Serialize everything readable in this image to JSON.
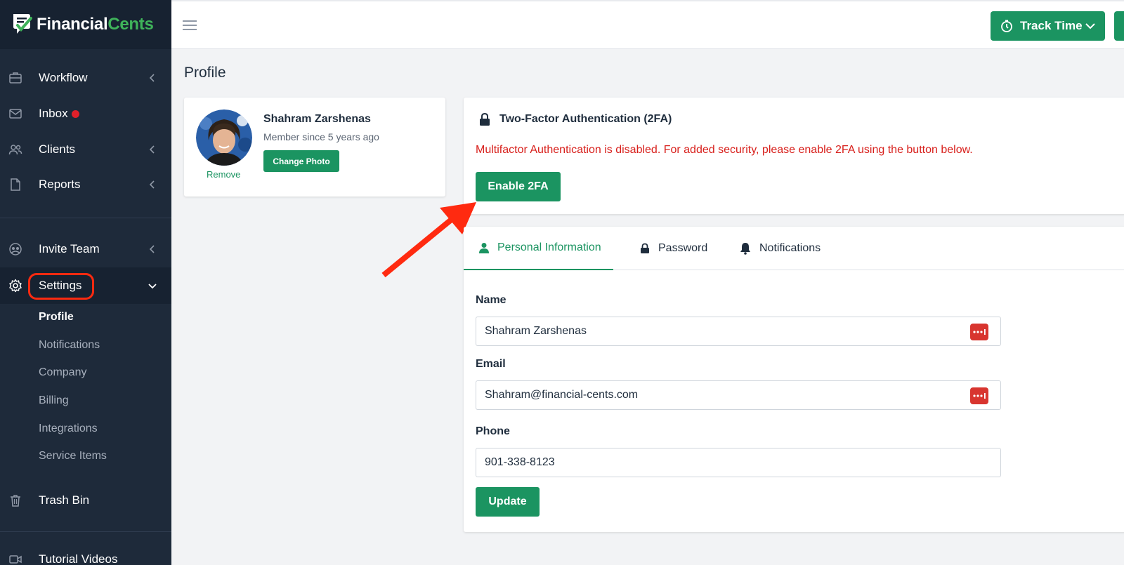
{
  "brand": {
    "name_a": "Financial",
    "name_b": "Cents",
    "green": "#1b9461",
    "sidebar_bg": "#1e2a3a",
    "alert_red": "#d8201c"
  },
  "sidebar": {
    "items": [
      {
        "label": "Workflow",
        "icon": "briefcase-icon"
      },
      {
        "label": "Inbox",
        "icon": "mail-icon"
      },
      {
        "label": "Clients",
        "icon": "users-icon"
      },
      {
        "label": "Reports",
        "icon": "file-icon"
      },
      {
        "label": "Invite Team",
        "icon": "team-icon"
      },
      {
        "label": "Settings",
        "icon": "gear-icon"
      },
      {
        "label": "Trash Bin",
        "icon": "trash-icon"
      },
      {
        "label": "Tutorial Videos",
        "icon": "video-icon"
      }
    ],
    "settings_sub": [
      "Profile",
      "Notifications",
      "Company",
      "Billing",
      "Integrations",
      "Service Items"
    ]
  },
  "topbar": {
    "track_time": "Track Time"
  },
  "page": {
    "title": "Profile"
  },
  "profile": {
    "name": "Shahram Zarshenas",
    "member_since": "Member since 5 years ago",
    "change_photo": "Change Photo",
    "remove": "Remove"
  },
  "twofa": {
    "title": "Two-Factor Authentication (2FA)",
    "message": "Multifactor Authentication is disabled. For added security, please enable 2FA using the button below.",
    "button": "Enable 2FA"
  },
  "tabs": [
    "Personal Information",
    "Password",
    "Notifications"
  ],
  "form": {
    "name_label": "Name",
    "name_value": "Shahram Zarshenas",
    "email_label": "Email",
    "email_value": "Shahram@financial-cents.com",
    "phone_label": "Phone",
    "phone_value": "901-338-8123",
    "update": "Update"
  }
}
